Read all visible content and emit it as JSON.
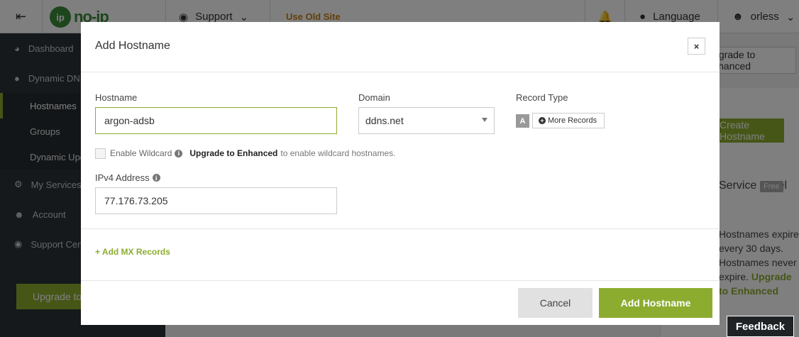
{
  "topbar": {
    "logo_text": "no-ip",
    "support_label": "Support",
    "old_site_label": "Use Old Site",
    "language_label": "Language",
    "user_label": "orless"
  },
  "sidebar": {
    "items": [
      {
        "label": "Dashboard",
        "icon": "dashboard-icon"
      },
      {
        "label": "Dynamic DNS",
        "icon": "globe-icon"
      },
      {
        "label": "My Services",
        "icon": "gear-icon"
      },
      {
        "label": "Account",
        "icon": "user-icon"
      },
      {
        "label": "Support Center",
        "icon": "lifebuoy-icon"
      }
    ],
    "subitems": [
      "Hostnames",
      "Groups",
      "Dynamic Update Client"
    ],
    "upgrade_label": "Upgrade to Enhanced"
  },
  "background": {
    "enhanced_button": "Upgrade to Enhanced",
    "hostname_button": "Create Hostname",
    "level_label": "Service Level",
    "free_badge": "Free",
    "expire_text_1": "Hostnames expire every 30 days.",
    "expire_text_2": "Hostnames never expire.",
    "expire_link": "Upgrade to Enhanced",
    "feedback_label": "Feedback"
  },
  "modal": {
    "title": "Add Hostname",
    "close_glyph": "×",
    "hostname_label": "Hostname",
    "hostname_value": "argon-adsb",
    "domain_label": "Domain",
    "domain_value": "ddns.net",
    "record_type_label": "Record Type",
    "record_type_value": "A",
    "more_records_label": "More Records",
    "wildcard_label": "Enable Wildcard",
    "wildcard_link": "Upgrade to Enhanced",
    "wildcard_after": "to enable wildcard hostnames.",
    "ipv4_label": "IPv4 Address",
    "ipv4_value": "77.176.73.205",
    "add_mx_label": "+ Add MX Records",
    "cancel_label": "Cancel",
    "submit_label": "Add Hostname"
  },
  "colors": {
    "brand_green": "#8cac2f",
    "sidebar_bg": "#2b3238",
    "old_site_orange": "#c77f16"
  }
}
